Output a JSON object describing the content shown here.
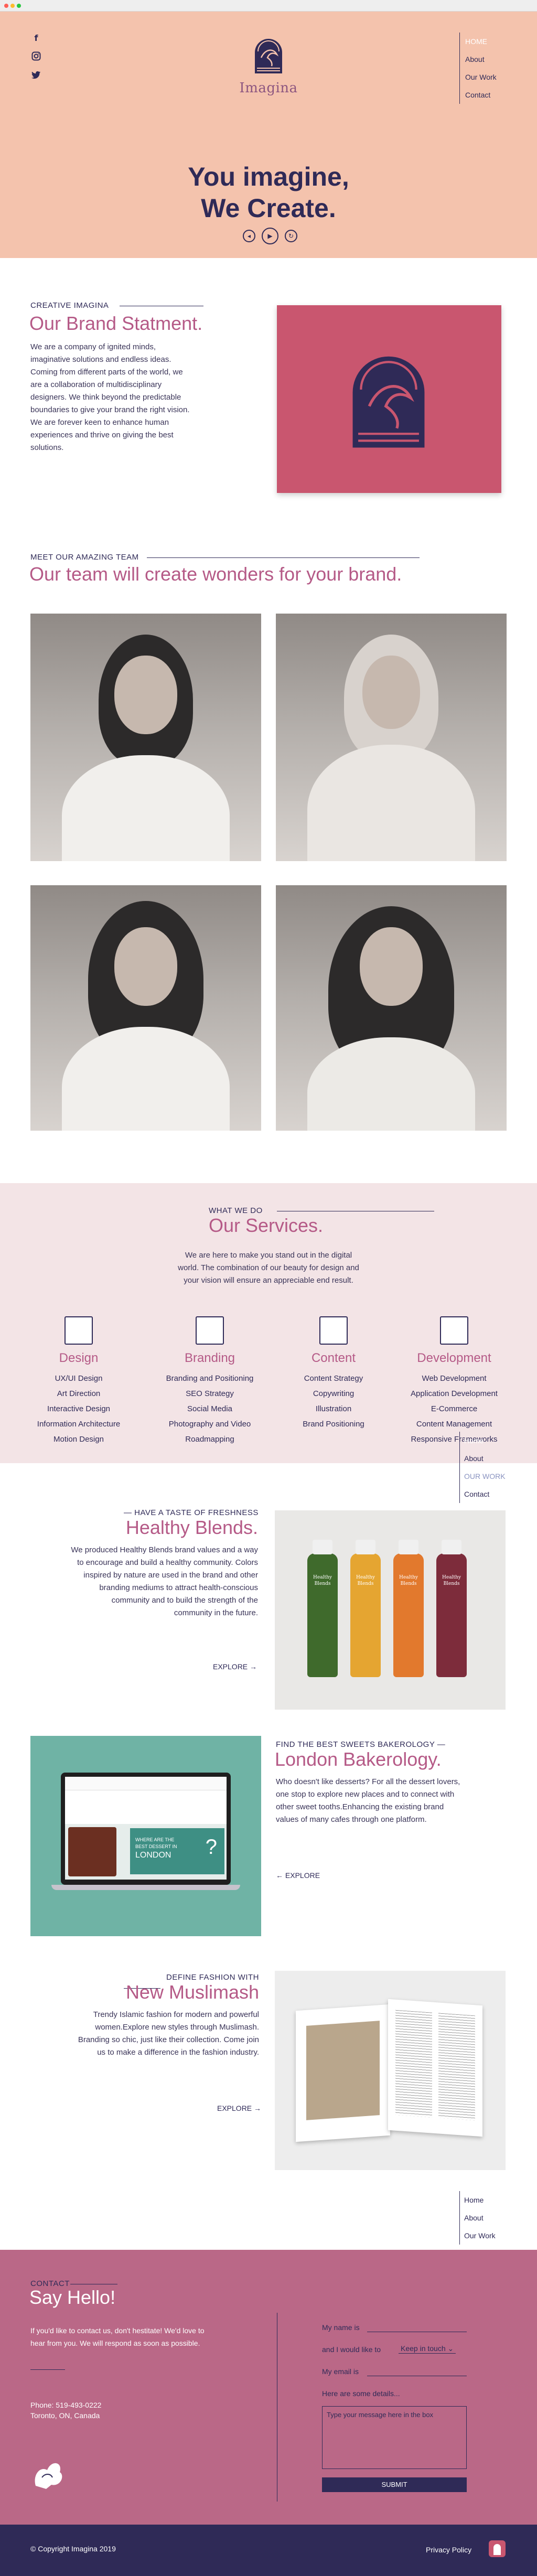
{
  "brand": {
    "name": "Imagina"
  },
  "nav": {
    "items": [
      "HOME",
      "About",
      "Our Work",
      "Contact"
    ]
  },
  "hero": {
    "line1": "You imagine,",
    "line2": "We Create."
  },
  "about": {
    "kicker": "CREATIVE IMAGINA",
    "title": "Our Brand Statment.",
    "lines": [
      "We are a company of ignited minds,",
      "imaginative solutions and endless ideas.",
      "Coming from different parts of the world, we",
      "are a collaboration of multidisciplinary",
      "designers. We think beyond the predictable",
      "boundaries to give your brand the right vision.",
      "We are forever keen to enhance human",
      "experiences and thrive on giving the best",
      "solutions."
    ]
  },
  "team": {
    "kicker": "MEET OUR AMAZING TEAM",
    "title": "Our team will create wonders for your brand."
  },
  "services": {
    "kicker": "WHAT WE DO",
    "title": "Our Services.",
    "intro": [
      "We are here to make you stand out in the digital",
      "world. The combination of our beauty for design and",
      "your vision will ensure an appreciable end result."
    ],
    "columns": [
      {
        "title": "Design",
        "icon": "layout-icon",
        "items": [
          "UX/UI Design",
          "Art Direction",
          "Interactive Design",
          "Information Architecture",
          "Motion Design"
        ]
      },
      {
        "title": "Branding",
        "icon": "branding-icon",
        "items": [
          "Branding and Positioning",
          "SEO Strategy",
          "Social Media",
          "Photography and Video",
          "Roadmapping"
        ]
      },
      {
        "title": "Content",
        "icon": "content-icon",
        "items": [
          "Content Strategy",
          "Copywriting",
          "Illustration",
          "Brand Positioning"
        ]
      },
      {
        "title": "Development",
        "icon": "code-icon",
        "items": [
          "Web Development",
          "Application Development",
          "E-Commerce",
          "Content Management",
          "Responsive Frameworks"
        ]
      }
    ]
  },
  "sidenav": {
    "items": [
      "Home",
      "About",
      "OUR WORK",
      "Contact"
    ]
  },
  "sidenav2": {
    "items": [
      "Home",
      "About",
      "Our Work"
    ]
  },
  "projects": {
    "healthy": {
      "kicker": "— HAVE A TASTE OF FRESHNESS",
      "title": "Healthy Blends.",
      "lines": [
        "We produced Healthy Blends brand values and a way",
        "to encourage and build a healthy community.  Colors",
        "inspired by nature are used in the brand and other",
        "branding mediums to attract health-conscious",
        "community and to build the strength of the",
        "community in the future."
      ],
      "explore": "EXPLORE →",
      "bottle_label": "Healthy Blends"
    },
    "bakery": {
      "kicker": "FIND THE BEST SWEETS BAKEROLOGY —",
      "title": "London Bakerology.",
      "lines": [
        "Who doesn't like desserts? For all the dessert lovers,",
        "one stop to explore new places and to connect with",
        "other sweet tooths.Enhancing the existing brand",
        "values of many cafes through one platform."
      ],
      "explore": "← EXPLORE",
      "screen_text": [
        "WHERE ARE THE",
        "BEST DESSERT IN",
        "LONDON",
        "?"
      ]
    },
    "fashion": {
      "kicker": "DEFINE FASHION WITH",
      "title": "New Muslimash",
      "lines": [
        "Trendy Islamic fashion for modern and powerful",
        "women.Explore new styles through Muslimash.",
        "Branding so chic, just like their collection. Come join",
        "us to make a difference in the fashion industry."
      ],
      "explore": "EXPLORE →"
    }
  },
  "contact": {
    "kicker": "CONTACT",
    "title": "Say Hello!",
    "lines": [
      "If you'd like to contact us, don't hestitate!  We'd love to",
      "hear from you. We will respond as soon as possible."
    ],
    "phone": "Phone: 519-493-0222",
    "city": "Toronto, ON, Canada",
    "form": {
      "name_label": "My name is",
      "touch_label": "and  I would like to",
      "touch_value": "Keep in touch",
      "email_label": "My email is",
      "details_label": "Here are some details...",
      "textarea_placeholder": "Type your message here in the box",
      "submit": "SUBMIT"
    }
  },
  "footer": {
    "copyright": "© Copyright Imagina 2019",
    "privacy": "Privacy Policy"
  },
  "colors": {
    "hero": "#f4c3ad",
    "navy": "#2f2a57",
    "pink": "#b55a87",
    "contact": "#ba6887",
    "services_bg": "#f3e4e6"
  }
}
